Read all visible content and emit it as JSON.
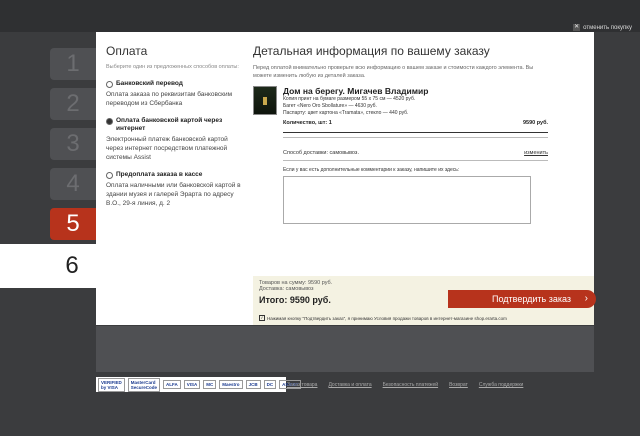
{
  "close_label": "✕",
  "close_text": "отменить покупку",
  "steps": [
    "1",
    "2",
    "3",
    "4",
    "5",
    "6"
  ],
  "payment": {
    "title": "Оплата",
    "subtitle": "Выберите один из предложенных способов оплаты:",
    "options": [
      {
        "title": "Банковский перевод",
        "desc": "Оплата заказа по реквизитам банковским переводом из Сбербанка",
        "selected": false
      },
      {
        "title": "Оплата банковской картой через интернет",
        "desc": "Электронный платеж банковской картой через интернет посредством платежной системы Assist",
        "selected": true
      },
      {
        "title": "Предоплата заказа в кассе",
        "desc": "Оплата наличными или банковской картой в здании музея и галерей Эрарта по адресу В.О., 29-я линия, д. 2",
        "selected": false
      }
    ]
  },
  "details": {
    "title": "Детальная информация по вашему заказу",
    "subtitle": "Перед оплатой внимательно проверьте всю информацию о вашем заказе и стоимости каждого элемента. Вы можете изменить любую из деталей заказа.",
    "product_title": "Дом на берегу. Мигачев Владимир",
    "line1": "Копия принт на бумаге размером 55 х 75 см — 4520 руб.",
    "line2": "Багет «Nero Oro Sbollature» — 4630 руб.",
    "line3": "Паспарту: цвет картона «Tramata», стекло — 440 руб.",
    "qty_label": "Количество, шт: 1",
    "qty_price": "9590 руб.",
    "delivery_label": "Способ доставки: самовывоз.",
    "delivery_change": "изменить",
    "comment_label": "Если у вас есть дополнительные комментарии к заказу, напишите их здесь:"
  },
  "summary": {
    "goods": "Товаров на сумму: 9590 руб.",
    "shipping": "Доставка: самовывоз",
    "total": "Итого: 9590 руб.",
    "confirm": "Подтвердить заказ",
    "agree": "Нажимая кнопку \"Подтвердить заказ\", я принимаю Условия продажи товаров в интернет-магазине shop.erarta.com"
  },
  "footer": {
    "links": [
      "Заказ товара",
      "Доставка и оплата",
      "Безопасность платежей",
      "Возврат",
      "Служба поддержки"
    ],
    "logos": [
      "VERIFIED by VISA",
      "MasterCard SecureCode",
      "ALFA",
      "VISA",
      "MC",
      "Maestro",
      "JCB",
      "DC",
      "ASSIST"
    ]
  }
}
